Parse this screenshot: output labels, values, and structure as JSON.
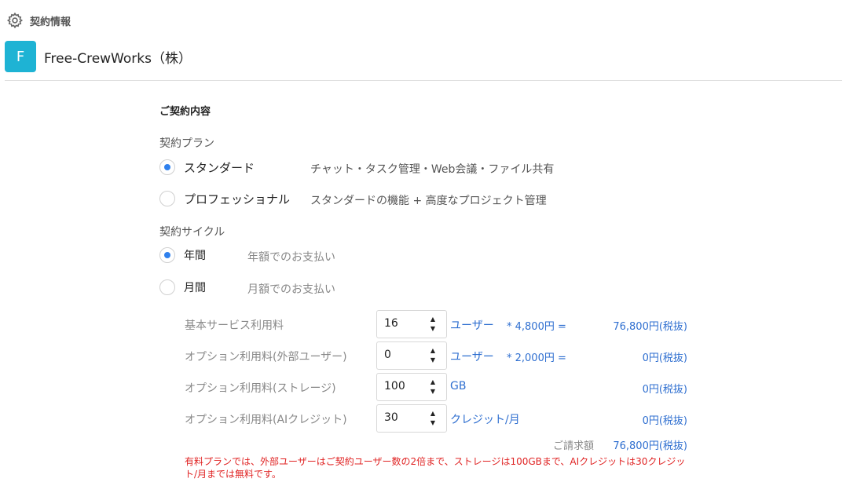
{
  "header": {
    "title": "契約情報",
    "icon": "gear-icon"
  },
  "company": {
    "avatar_letter": "F",
    "avatar_color": "#1eb3d4",
    "name": "Free-CrewWorks（株）"
  },
  "contract": {
    "section_title": "ご契約内容",
    "plan_label": "契約プラン",
    "plans": [
      {
        "label": "スタンダード",
        "description": "チャット・タスク管理・Web会議・ファイル共有",
        "selected": true
      },
      {
        "label": "プロフェッショナル",
        "description": "スタンダードの機能 + 高度なプロジェクト管理",
        "selected": false
      }
    ],
    "cycle_label": "契約サイクル",
    "cycles": [
      {
        "label": "年間",
        "description": "年額でのお支払い",
        "selected": true
      },
      {
        "label": "月間",
        "description": "月額でのお支払い",
        "selected": false
      }
    ]
  },
  "fees": [
    {
      "label": "基本サービス利用料",
      "value": "16",
      "unit": "ユーザー",
      "rate": "* 4,800円 =",
      "amount": "76,800円(税抜)"
    },
    {
      "label": "オプション利用料(外部ユーザー)",
      "value": "0",
      "unit": "ユーザー",
      "rate": "* 2,000円 =",
      "amount": "0円(税抜)"
    },
    {
      "label": "オプション利用料(ストレージ)",
      "value": "100",
      "unit": "GB",
      "rate": "",
      "amount": "0円(税抜)"
    },
    {
      "label": "オプション利用料(AIクレジット)",
      "value": "30",
      "unit": "クレジット/月",
      "rate": "",
      "amount": "0円(税抜)"
    }
  ],
  "total": {
    "label": "ご請求額",
    "amount": "76,800円(税抜)"
  },
  "note": "有料プランでは、外部ユーザーはご契約ユーザー数の2倍まで、ストレージは100GBまで、AIクレジットは30クレジット/月までは無料です。",
  "colors": {
    "accent": "#2f80ed",
    "amount_text": "#2f6fd0",
    "warning": "#e02424"
  }
}
